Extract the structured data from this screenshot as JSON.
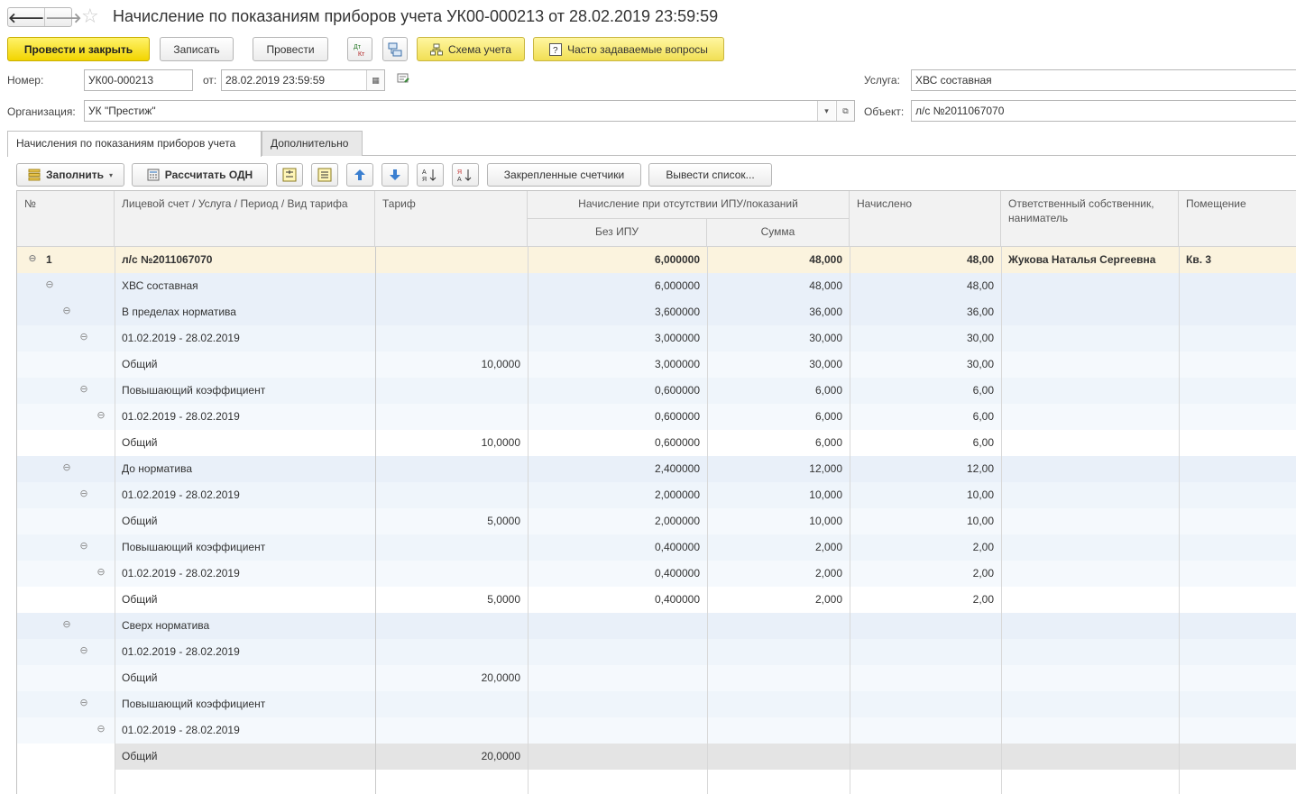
{
  "nav": {
    "back_glyph": "🡐",
    "forward_glyph": "🡒"
  },
  "title": "Начисление по показаниям приборов учета УК00-000213 от 28.02.2019 23:59:59",
  "commands": {
    "post_and_close": "Провести и закрыть",
    "save": "Записать",
    "post": "Провести",
    "dt_kt": "Дт\nКт",
    "scheme": "Схема учета",
    "faq": "Часто задаваемые вопросы"
  },
  "form": {
    "number_label": "Номер:",
    "number_value": "УК00-000213",
    "date_label": "от:",
    "date_value": "28.02.2019 23:59:59",
    "org_label": "Организация:",
    "org_value": "УК \"Престиж\"",
    "service_label": "Услуга:",
    "service_value": "ХВС составная",
    "object_label": "Объект:",
    "object_value": "л/с №2011067070"
  },
  "tabs": [
    "Начисления по показаниям приборов учета",
    "Дополнительно"
  ],
  "table_toolbar": {
    "fill": "Заполнить",
    "calc_odn": "Рассчитать ОДН",
    "pinned_meters": "Закрепленные счетчики",
    "output_list": "Вывести список..."
  },
  "columns": {
    "no": "№",
    "account": "Лицевой счет / Услуга / Период / Вид тарифа",
    "tariff": "Тариф",
    "no_ipu_group": "Начисление при отсутствии ИПУ/показаний",
    "no_ipu": "Без ИПУ",
    "sum": "Сумма",
    "charged": "Начислено",
    "owner": "Ответственный собственник, наниматель",
    "premises": "Помещение"
  },
  "rows": [
    {
      "level": 0,
      "no": "1",
      "name": "л/с №2011067070",
      "tariff": "",
      "no_ipu": "6,000000",
      "sum": "48,000",
      "charged": "48,00",
      "owner": "Жукова Наталья Сергеевна",
      "premises": "Кв. 3",
      "bold": true,
      "collapsible": true
    },
    {
      "level": 1,
      "no": "",
      "name": "ХВС составная",
      "tariff": "",
      "no_ipu": "6,000000",
      "sum": "48,000",
      "charged": "48,00",
      "owner": "",
      "premises": "",
      "collapsible": true
    },
    {
      "level": 2,
      "no": "",
      "name": "В пределах норматива",
      "tariff": "",
      "no_ipu": "3,600000",
      "sum": "36,000",
      "charged": "36,00",
      "owner": "",
      "premises": "",
      "collapsible": true
    },
    {
      "level": 3,
      "no": "",
      "name": "01.02.2019 - 28.02.2019",
      "tariff": "",
      "no_ipu": "3,000000",
      "sum": "30,000",
      "charged": "30,00",
      "owner": "",
      "premises": "",
      "collapsible": true
    },
    {
      "level": 4,
      "no": "",
      "name": "Общий",
      "tariff": "10,0000",
      "no_ipu": "3,000000",
      "sum": "30,000",
      "charged": "30,00",
      "owner": "",
      "premises": "",
      "collapsible": false
    },
    {
      "level": 3,
      "no": "",
      "name": "Повышающий коэффициент",
      "tariff": "",
      "no_ipu": "0,600000",
      "sum": "6,000",
      "charged": "6,00",
      "owner": "",
      "premises": "",
      "collapsible": true
    },
    {
      "level": 4,
      "no": "",
      "name": "01.02.2019 - 28.02.2019",
      "tariff": "",
      "no_ipu": "0,600000",
      "sum": "6,000",
      "charged": "6,00",
      "owner": "",
      "premises": "",
      "collapsible": true
    },
    {
      "level": 5,
      "no": "",
      "name": "Общий",
      "tariff": "10,0000",
      "no_ipu": "0,600000",
      "sum": "6,000",
      "charged": "6,00",
      "owner": "",
      "premises": "",
      "collapsible": false
    },
    {
      "level": 2,
      "no": "",
      "name": "До норматива",
      "tariff": "",
      "no_ipu": "2,400000",
      "sum": "12,000",
      "charged": "12,00",
      "owner": "",
      "premises": "",
      "collapsible": true
    },
    {
      "level": 3,
      "no": "",
      "name": "01.02.2019 - 28.02.2019",
      "tariff": "",
      "no_ipu": "2,000000",
      "sum": "10,000",
      "charged": "10,00",
      "owner": "",
      "premises": "",
      "collapsible": true
    },
    {
      "level": 4,
      "no": "",
      "name": "Общий",
      "tariff": "5,0000",
      "no_ipu": "2,000000",
      "sum": "10,000",
      "charged": "10,00",
      "owner": "",
      "premises": "",
      "collapsible": false
    },
    {
      "level": 3,
      "no": "",
      "name": "Повышающий коэффициент",
      "tariff": "",
      "no_ipu": "0,400000",
      "sum": "2,000",
      "charged": "2,00",
      "owner": "",
      "premises": "",
      "collapsible": true
    },
    {
      "level": 4,
      "no": "",
      "name": "01.02.2019 - 28.02.2019",
      "tariff": "",
      "no_ipu": "0,400000",
      "sum": "2,000",
      "charged": "2,00",
      "owner": "",
      "premises": "",
      "collapsible": true
    },
    {
      "level": 5,
      "no": "",
      "name": "Общий",
      "tariff": "5,0000",
      "no_ipu": "0,400000",
      "sum": "2,000",
      "charged": "2,00",
      "owner": "",
      "premises": "",
      "collapsible": false
    },
    {
      "level": 2,
      "no": "",
      "name": "Сверх норматива",
      "tariff": "",
      "no_ipu": "",
      "sum": "",
      "charged": "",
      "owner": "",
      "premises": "",
      "collapsible": true
    },
    {
      "level": 3,
      "no": "",
      "name": "01.02.2019 - 28.02.2019",
      "tariff": "",
      "no_ipu": "",
      "sum": "",
      "charged": "",
      "owner": "",
      "premises": "",
      "collapsible": true
    },
    {
      "level": 4,
      "no": "",
      "name": "Общий",
      "tariff": "20,0000",
      "no_ipu": "",
      "sum": "",
      "charged": "",
      "owner": "",
      "premises": "",
      "collapsible": false
    },
    {
      "level": 3,
      "no": "",
      "name": "Повышающий коэффициент",
      "tariff": "",
      "no_ipu": "",
      "sum": "",
      "charged": "",
      "owner": "",
      "premises": "",
      "collapsible": true
    },
    {
      "level": 4,
      "no": "",
      "name": "01.02.2019 - 28.02.2019",
      "tariff": "",
      "no_ipu": "",
      "sum": "",
      "charged": "",
      "owner": "",
      "premises": "",
      "collapsible": true
    },
    {
      "level": 5,
      "no": "",
      "name": "Общий",
      "tariff": "20,0000",
      "no_ipu": "",
      "sum": "",
      "charged": "",
      "owner": "",
      "premises": "",
      "collapsible": false,
      "selected": true
    }
  ],
  "colors": {
    "level0": "#fbf3de",
    "level1": "#e9f0f9",
    "level2": "#e9f0f9",
    "level3": "#eff5fb",
    "level4": "#f5f9fd",
    "level5": "#ffffff",
    "selected": "#e4e4e4",
    "accent_yellow": "#f2d400"
  }
}
